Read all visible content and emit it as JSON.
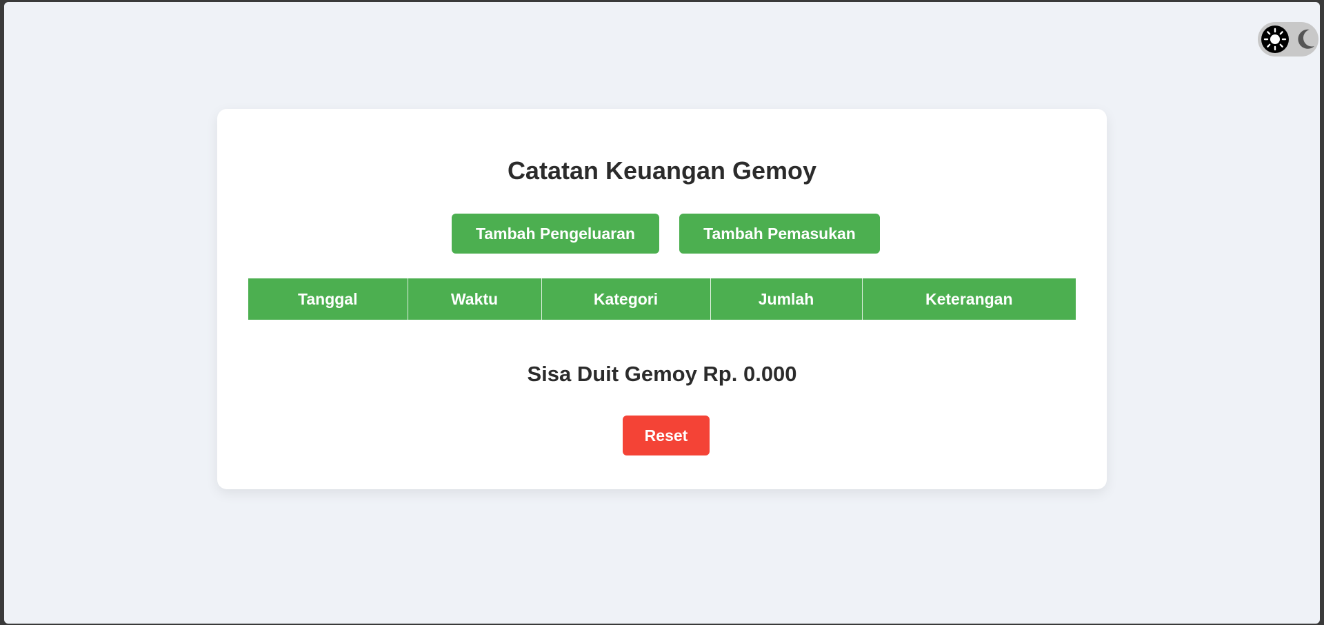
{
  "theme_toggle": {
    "sun_icon": "sun-icon",
    "moon_icon": "moon-icon"
  },
  "app": {
    "title": "Catatan Keuangan Gemoy"
  },
  "actions": {
    "add_expense_label": "Tambah Pengeluaran",
    "add_income_label": "Tambah Pemasukan",
    "reset_label": "Reset"
  },
  "table": {
    "headers": [
      "Tanggal",
      "Waktu",
      "Kategori",
      "Jumlah",
      "Keterangan"
    ],
    "rows": []
  },
  "balance": {
    "text": "Sisa Duit Gemoy Rp. 0.000"
  },
  "colors": {
    "background": "#eff2f7",
    "primary_green": "#4caf50",
    "danger_red": "#f44336",
    "text_dark": "#2b2b2b"
  }
}
